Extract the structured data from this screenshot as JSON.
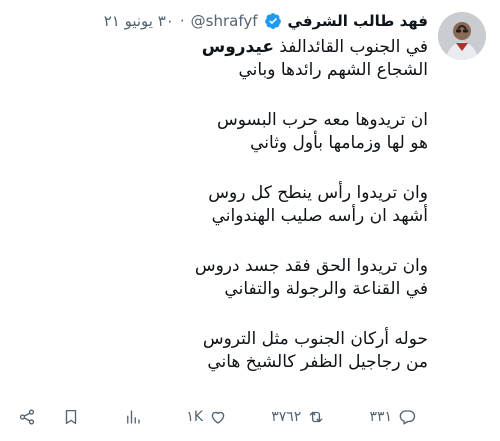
{
  "author": {
    "display_name": "فهد طالب الشرفي",
    "handle": "@shrafyf",
    "separator": "·",
    "date": "٣٠ يونيو ٢١",
    "verified": true
  },
  "tweet": {
    "line1_prefix": "في الجنوب القائدالفذ ",
    "line1_bold": "عيدروس",
    "line2": "الشجاع الشهم رائدها وباني",
    "line3": "ان تريدوها معه حرب البسوس",
    "line4": "هو لها وزمامها بأول وثاني",
    "line5": "وان تريدوا رأس ينطح كل روس",
    "line6": "أشهد ان رأسه صليب الهندواني",
    "line7": "وان تريدوا الحق فقد جسد دروس",
    "line8": "في القناعة والرجولة والتفاني",
    "line9": "حوله أركان الجنوب مثل التروس",
    "line10": "من رجاجيل الظفر كالشيخ هاني"
  },
  "actions": {
    "reply_count": "٣٣١",
    "retweet_count": "٣٧٦٢",
    "like_count": "١K",
    "reply_icon": "reply-icon",
    "retweet_icon": "retweet-icon",
    "like_icon": "heart-icon",
    "views_icon": "views-icon",
    "bookmark_icon": "bookmark-icon",
    "share_icon": "share-icon"
  },
  "colors": {
    "text": "#0f1419",
    "secondary": "#536471",
    "verified": "#1d9bf0"
  }
}
